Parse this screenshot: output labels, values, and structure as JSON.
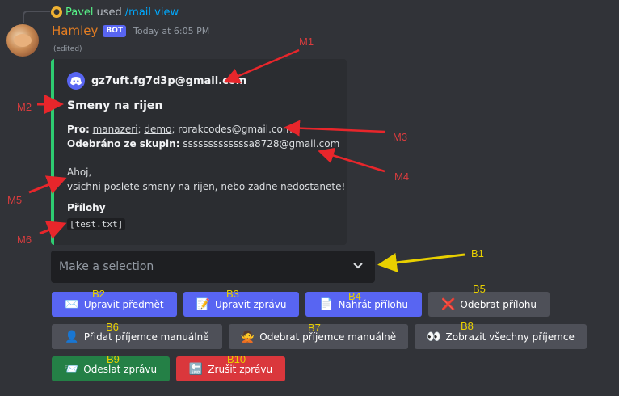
{
  "reply": {
    "user": "Pavel",
    "used": "used",
    "command": "/mail view"
  },
  "message": {
    "username": "Hamley",
    "badge": "BOT",
    "timestamp": "Today at 6:05 PM",
    "edited": "(edited)"
  },
  "embed": {
    "author": "gz7uft.fg7d3p@gmail.com",
    "title": "Smeny na rijen",
    "to_label": "Pro:",
    "to_links": [
      "manazeri",
      "demo"
    ],
    "to_rest": "rorakcodes@gmail.com",
    "removed_label": "Odebráno ze skupin:",
    "removed_value": "sssssssssssssa8728@gmail.com",
    "greeting": "Ahoj,",
    "body": "vsichni poslete smeny na rijen, nebo zadne nedostanete!",
    "attachments_label": "Přílohy",
    "attachment": "[test.txt]"
  },
  "select": {
    "placeholder": "Make a selection"
  },
  "buttons": [
    {
      "label": "Upravit předmět",
      "emoji": "✉️"
    },
    {
      "label": "Upravit zprávu",
      "emoji": "📝"
    },
    {
      "label": "Nahrát přílohu",
      "emoji": "📄"
    },
    {
      "label": "Odebrat přílohu",
      "emoji": "❌"
    },
    {
      "label": "Přidat příjemce manuálně",
      "emoji": "👤"
    },
    {
      "label": "Odebrat příjemce manuálně",
      "emoji": "🙅"
    },
    {
      "label": "Zobrazit všechny příjemce",
      "emoji": "👀"
    },
    {
      "label": "Odeslat zprávu",
      "emoji": "📨"
    },
    {
      "label": "Zrušit zprávu",
      "emoji": "🔚"
    }
  ],
  "annotations": {
    "m1": "M1",
    "m2": "M2",
    "m3": "M3",
    "m4": "M4",
    "m5": "M5",
    "m6": "M6",
    "b1": "B1",
    "b2": "B2",
    "b3": "B3",
    "b4": "B4",
    "b5": "B5",
    "b6": "B6",
    "b7": "B7",
    "b8": "B8",
    "b9": "B9",
    "b10": "B10"
  },
  "colors": {
    "accent": "#2ecc71",
    "blurple": "#5865f2",
    "annotation_red": "#d83c3e",
    "annotation_yellow": "#e8d000"
  }
}
